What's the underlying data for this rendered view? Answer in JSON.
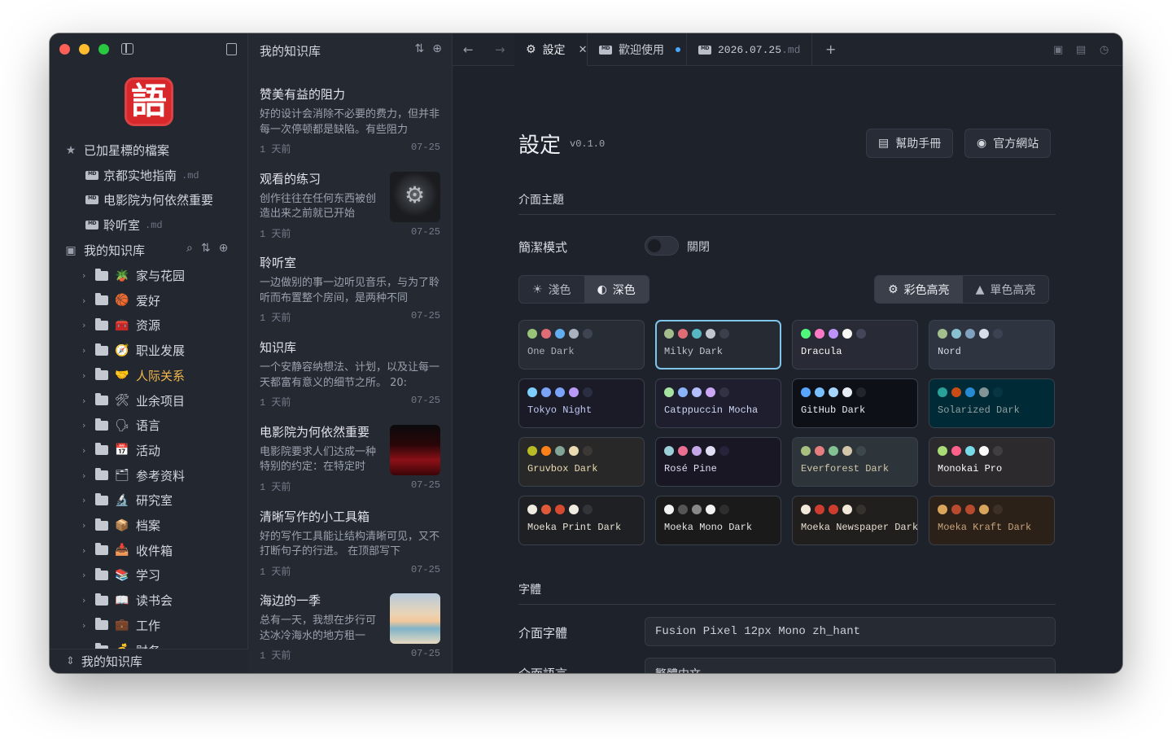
{
  "sidebar": {
    "logo_glyph": "語",
    "starred_heading": "已加星標的檔案",
    "starred": [
      {
        "name": "京都实地指南",
        "ext": ".md"
      },
      {
        "name": "电影院为何依然重要",
        "ext": ""
      },
      {
        "name": "聆听室",
        "ext": ".md"
      }
    ],
    "kb_heading": "我的知识库",
    "folders": [
      {
        "emoji": "🪴",
        "label": "家与花园"
      },
      {
        "emoji": "🏀",
        "label": "爱好"
      },
      {
        "emoji": "🧰",
        "label": "资源"
      },
      {
        "emoji": "🧭",
        "label": "职业发展"
      },
      {
        "emoji": "🤝",
        "label": "人际关系"
      },
      {
        "emoji": "🛠",
        "label": "业余项目"
      },
      {
        "emoji": "🗣",
        "label": "语言"
      },
      {
        "emoji": "📅",
        "label": "活动"
      },
      {
        "emoji": "🗂",
        "label": "参考资料"
      },
      {
        "emoji": "🔬",
        "label": "研究室"
      },
      {
        "emoji": "📦",
        "label": "档案"
      },
      {
        "emoji": "📥",
        "label": "收件箱"
      },
      {
        "emoji": "📚",
        "label": "学习"
      },
      {
        "emoji": "📖",
        "label": "读书会"
      },
      {
        "emoji": "💼",
        "label": "工作"
      },
      {
        "emoji": "💰",
        "label": "财务"
      }
    ],
    "footer_label": "我的知识库"
  },
  "notelist": {
    "heading": "我的知识库",
    "notes": [
      {
        "title": "赞美有益的阻力",
        "excerpt": "好的设计会消除不必要的费力，但并非每一次停顿都是缺陷。有些阻力",
        "age": "1 天前",
        "date": "07-25",
        "thumb": ""
      },
      {
        "title": "观看的练习",
        "excerpt": "创作往往在任何东西被创造出来之前就已开始",
        "age": "1 天前",
        "date": "07-25",
        "thumb": "gear"
      },
      {
        "title": "聆听室",
        "excerpt": "一边做别的事一边听见音乐，与为了聆听而布置整个房间，是两种不同",
        "age": "1 天前",
        "date": "07-25",
        "thumb": ""
      },
      {
        "title": "知识库",
        "excerpt": "一个安静容纳想法、计划，以及让每一天都富有意义的细节之所。 20:",
        "age": "1 天前",
        "date": "07-25",
        "thumb": ""
      },
      {
        "title": "电影院为何依然重要",
        "excerpt": "电影院要求人们达成一种特别的约定：在特定时",
        "age": "1 天前",
        "date": "07-25",
        "thumb": "cinema"
      },
      {
        "title": "清晰写作的小工具箱",
        "excerpt": "好的写作工具能让结构清晰可见，又不打断句子的行进。 在顶部写下",
        "age": "1 天前",
        "date": "07-25",
        "thumb": ""
      },
      {
        "title": "海边的一季",
        "excerpt": "总有一天，我想在步行可达冰冷海水的地方租一",
        "age": "1 天前",
        "date": "07-25",
        "thumb": "beach"
      }
    ]
  },
  "tabs": [
    {
      "label": "設定",
      "mono": false
    },
    {
      "label": "歡迎使用",
      "mono": false
    },
    {
      "label": "2026.07.25",
      "ext": ".md",
      "mono": true
    }
  ],
  "settings": {
    "title": "設定",
    "version": "v0.1.0",
    "help_button": "幫助手冊",
    "website_button": "官方網站",
    "theme_section": "介面主題",
    "clean_mode_label": "簡潔模式",
    "clean_mode_state": "關閉",
    "light_label": "淺色",
    "dark_label": "深色",
    "color_highlight": "彩色高亮",
    "mono_highlight": "單色高亮",
    "font_section": "字體",
    "ui_font_label": "介面字體",
    "ui_font_value": "Fusion Pixel 12px Mono zh_hant",
    "ui_lang_label": "介面語言",
    "ui_lang_value": "繁體中文"
  },
  "themes": [
    {
      "name": "One Dark",
      "bg": "#282c34",
      "fg": "#abb2bf",
      "dots": [
        "#98c379",
        "#e06c75",
        "#61afef",
        "#abb2bf",
        "#3e4451"
      ],
      "selected": false
    },
    {
      "name": "Milky Dark",
      "bg": "#262a33",
      "fg": "#c0c5ce",
      "dots": [
        "#a3be8c",
        "#e06c75",
        "#56b6c2",
        "#c0c5ce",
        "#3a3f4b"
      ],
      "selected": true
    },
    {
      "name": "Dracula",
      "bg": "#282a36",
      "fg": "#f8f8f2",
      "dots": [
        "#50fa7b",
        "#ff79c6",
        "#bd93f9",
        "#f8f8f2",
        "#44475a"
      ],
      "selected": false
    },
    {
      "name": "Nord",
      "bg": "#2e3440",
      "fg": "#d8dee9",
      "dots": [
        "#a3be8c",
        "#88c0d0",
        "#81a1c1",
        "#d8dee9",
        "#3b4252"
      ],
      "selected": false
    },
    {
      "name": "Tokyo Night",
      "bg": "#1a1b26",
      "fg": "#c0caf5",
      "dots": [
        "#7dcfff",
        "#7aa2f7",
        "#7aa2f7",
        "#bb9af7",
        "#292e42"
      ],
      "selected": false
    },
    {
      "name": "Catppuccin Mocha",
      "bg": "#1e1e2e",
      "fg": "#cdd6f4",
      "dots": [
        "#a6e3a1",
        "#89b4fa",
        "#b4befe",
        "#cba6f7",
        "#313244"
      ],
      "selected": false
    },
    {
      "name": "GitHub Dark",
      "bg": "#0d1117",
      "fg": "#e6edf3",
      "dots": [
        "#58a6ff",
        "#79c0ff",
        "#a5d6ff",
        "#e6edf3",
        "#21262d"
      ],
      "selected": false
    },
    {
      "name": "Solarized Dark",
      "bg": "#002b36",
      "fg": "#93a1a1",
      "dots": [
        "#2aa198",
        "#cb4b16",
        "#268bd2",
        "#839496",
        "#073642"
      ],
      "selected": false
    },
    {
      "name": "Gruvbox Dark",
      "bg": "#282828",
      "fg": "#ebdbb2",
      "dots": [
        "#b8bb26",
        "#fe8019",
        "#83a598",
        "#ebdbb2",
        "#3c3836"
      ],
      "selected": false
    },
    {
      "name": "Rosé Pine",
      "bg": "#191724",
      "fg": "#e0def4",
      "dots": [
        "#9ccfd8",
        "#eb6f92",
        "#c4a7e7",
        "#e0def4",
        "#26233a"
      ],
      "selected": false
    },
    {
      "name": "Everforest Dark",
      "bg": "#2d353b",
      "fg": "#d3c6aa",
      "dots": [
        "#a7c080",
        "#e67e80",
        "#83c092",
        "#d3c6aa",
        "#3d484d"
      ],
      "selected": false
    },
    {
      "name": "Monokai Pro",
      "bg": "#2d2a2e",
      "fg": "#fcfcfa",
      "dots": [
        "#a9dc76",
        "#ff6188",
        "#78dce8",
        "#fcfcfa",
        "#403e41"
      ],
      "selected": false
    },
    {
      "name": "Moeka Print Dark",
      "bg": "#1f2024",
      "fg": "#e8e2d4",
      "dots": [
        "#f0ebe0",
        "#e05a3a",
        "#d64a32",
        "#f0ebe0",
        "#33343a"
      ],
      "selected": false
    },
    {
      "name": "Moeka Mono Dark",
      "bg": "#1a1a1a",
      "fg": "#e6e6e6",
      "dots": [
        "#f2f2f2",
        "#555555",
        "#888888",
        "#f2f2f2",
        "#2e2e2e"
      ],
      "selected": false
    },
    {
      "name": "Moeka Newspaper Dark",
      "bg": "#211f1d",
      "fg": "#e6ddcf",
      "dots": [
        "#f1e8da",
        "#cc3d2f",
        "#cc3d2f",
        "#f1e8da",
        "#35312d"
      ],
      "selected": false
    },
    {
      "name": "Moeka Kraft Dark",
      "bg": "#2b2119",
      "fg": "#c7a27a",
      "dots": [
        "#d9a45c",
        "#b84a2e",
        "#b84a2e",
        "#d9a45c",
        "#3d3026"
      ],
      "selected": false
    }
  ]
}
